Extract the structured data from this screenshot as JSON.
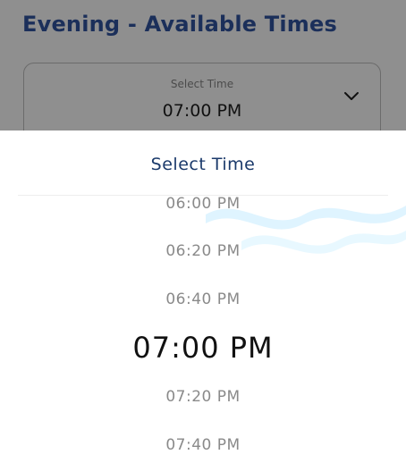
{
  "header": {
    "title": "Evening - Available Times"
  },
  "select_field": {
    "label": "Select Time",
    "value": "07:00 PM",
    "icon": "chevron-down-icon"
  },
  "picker": {
    "title": "Select Time",
    "options": [
      "06:00 PM",
      "06:20 PM",
      "06:40 PM",
      "07:00 PM",
      "07:20 PM",
      "07:40 PM"
    ],
    "selected": "07:00 PM"
  },
  "colors": {
    "title_text": "#1b2f5a",
    "picker_title": "#1b3a6b",
    "dim_overlay": "#8f8f8f",
    "option_text": "#8a8a8a",
    "selected_text": "#111111",
    "wave_accent": "#cfefff"
  }
}
